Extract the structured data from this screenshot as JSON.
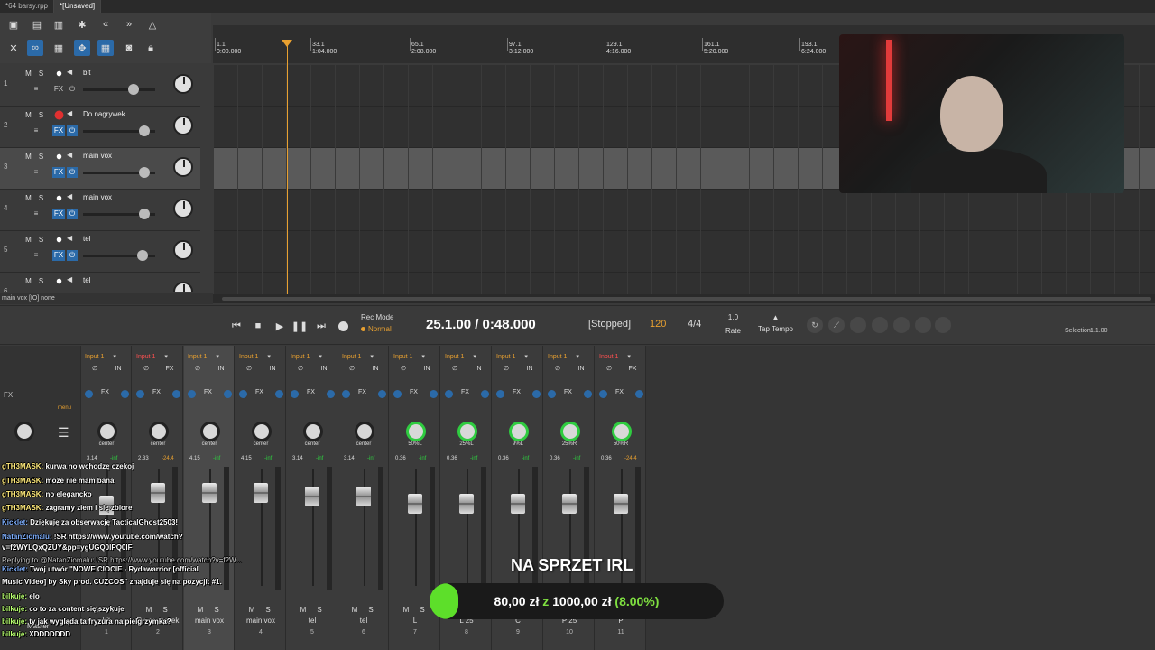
{
  "titlebar": {
    "tabs": [
      "*64 barsy.rpp",
      "*[Unsaved]"
    ]
  },
  "toolbar": {
    "icons": [
      "new-project-icon",
      "open-icon",
      "save-icon",
      "settings-icon",
      "rewind-icon",
      "fast-forward-icon",
      "metronome-icon",
      "grid-icon",
      "ripple-icon",
      "snap-icon",
      "lock-icon"
    ]
  },
  "ruler": {
    "marks": [
      {
        "bar": "1.1",
        "time": "0:00.000"
      },
      {
        "bar": "33.1",
        "time": "1:04.000"
      },
      {
        "bar": "65.1",
        "time": "2:08.000"
      },
      {
        "bar": "97.1",
        "time": "3:12.000"
      },
      {
        "bar": "129.1",
        "time": "4:16.000"
      },
      {
        "bar": "161.1",
        "time": "5:20.000"
      },
      {
        "bar": "193.1",
        "time": "6:24.000"
      }
    ]
  },
  "tracks": [
    {
      "num": "1",
      "name": "bit",
      "armed": false,
      "fx_on": false,
      "selected": false
    },
    {
      "num": "2",
      "name": "Do nagrywek",
      "armed": true,
      "fx_on": true,
      "selected": false
    },
    {
      "num": "3",
      "name": "main vox",
      "armed": false,
      "fx_on": true,
      "selected": true
    },
    {
      "num": "4",
      "name": "main vox",
      "armed": false,
      "fx_on": true,
      "selected": false
    },
    {
      "num": "5",
      "name": "tel",
      "armed": false,
      "fx_on": true,
      "selected": false
    },
    {
      "num": "6",
      "name": "tel",
      "armed": false,
      "fx_on": true,
      "selected": false
    }
  ],
  "track_labels": {
    "mute": "M",
    "solo": "S",
    "fx": "FX"
  },
  "status_line": "main vox [IO] none",
  "transport": {
    "rec_mode_label": "Rec Mode",
    "rec_mode_value": "Normal",
    "position": "25.1.00 / 0:48.000",
    "state": "[Stopped]",
    "bpm": "120",
    "time_sig": "4/4",
    "rate_value": "1.0",
    "rate_label": "Rate",
    "tap_tempo_label": "Tap Tempo",
    "selection_label": "Selection:",
    "selection_value": "1.1.00"
  },
  "mixer": {
    "master_label": "Master",
    "menu_label": "menu",
    "strips": [
      {
        "input": "Input 1",
        "armed": false,
        "pan": "center",
        "vol": "3.14",
        "peak": "-inf",
        "name": "bit",
        "num": "1"
      },
      {
        "input": "Input 1",
        "armed": true,
        "pan": "center",
        "vol": "2.33",
        "peak": "-24.4",
        "name": "Do nagrywek",
        "num": "2"
      },
      {
        "input": "Input 1",
        "armed": false,
        "pan": "center",
        "vol": "4.15",
        "peak": "-inf",
        "name": "main vox",
        "num": "3"
      },
      {
        "input": "Input 1",
        "armed": false,
        "pan": "center",
        "vol": "4.15",
        "peak": "-inf",
        "name": "main vox",
        "num": "4"
      },
      {
        "input": "Input 1",
        "armed": false,
        "pan": "center",
        "vol": "3.14",
        "peak": "-inf",
        "name": "tel",
        "num": "5"
      },
      {
        "input": "Input 1",
        "armed": false,
        "pan": "center",
        "vol": "3.14",
        "peak": "-inf",
        "name": "tel",
        "num": "6"
      },
      {
        "input": "Input 1",
        "armed": false,
        "pan": "50%L",
        "vol": "0.36",
        "peak": "-inf",
        "name": "L",
        "num": "7"
      },
      {
        "input": "Input 1",
        "armed": false,
        "pan": "25%L",
        "vol": "0.36",
        "peak": "-inf",
        "name": "L 25",
        "num": "8"
      },
      {
        "input": "Input 1",
        "armed": false,
        "pan": "9%L",
        "vol": "0.36",
        "peak": "-inf",
        "name": "C",
        "num": "9"
      },
      {
        "input": "Input 1",
        "armed": false,
        "pan": "25%R",
        "vol": "0.36",
        "peak": "-inf",
        "name": "P 25",
        "num": "10"
      },
      {
        "input": "Input 1",
        "armed": true,
        "pan": "50%R",
        "vol": "0.36",
        "peak": "-24.4",
        "name": "P",
        "num": "11"
      }
    ]
  },
  "chat": [
    {
      "user": "gTH3MASK:",
      "msg": "kurwa no wchodzę czekoj",
      "color": "y"
    },
    {
      "user": "gTH3MASK:",
      "msg": "może nie mam bana",
      "color": "y"
    },
    {
      "user": "gTH3MASK:",
      "msg": "no elegancko",
      "color": "y"
    },
    {
      "user": "gTH3MASK:",
      "msg": "zagramy ziem i się zbiore",
      "color": "y"
    },
    {
      "user": "Kicklet:",
      "msg": "Dziękuję za obserwację TacticalGhost2503!",
      "color": "b"
    },
    {
      "user": "NatanZiomalu:",
      "msg": "!SR https://www.youtube.com/watch?",
      "color": "b"
    },
    {
      "user": "",
      "msg": "v=f2WYLQxQZUY&pp=ygUGQ0lPQ0lF",
      "color": "w"
    },
    {
      "user": "",
      "msg": "Replying to @NatanZiomalu: !SR https://www.youtube.com/watch?v=f2W...",
      "color": "s"
    },
    {
      "user": "Kicklet:",
      "msg": "Twój utwór \"NOWE CIOCIE - Rydawarrior [official",
      "color": "b"
    },
    {
      "user": "",
      "msg": "Music Video] by Sky prod. CUZCOS\" znajduje się na pozycji: #1.",
      "color": "w"
    },
    {
      "user": "bilkuje:",
      "msg": "elo",
      "color": "g"
    },
    {
      "user": "bilkuje:",
      "msg": "co to za content się szykuje",
      "color": "g"
    },
    {
      "user": "bilkuje:",
      "msg": "ty jak wygląda ta fryzura na pielgrzymka?",
      "color": "g"
    },
    {
      "user": "bilkuje:",
      "msg": "XDDDDDDD",
      "color": "g"
    }
  ],
  "goal": {
    "title": "NA SPRZET IRL",
    "current": "80,00 zł",
    "sep": "z",
    "target": "1000,00 zł",
    "percent_text": "(8.00%)",
    "progress": 0.08
  },
  "colors": {
    "accent_blue": "#2b6aa8",
    "accent_orange": "#e8a030",
    "rec_red": "#e03030",
    "goal_green": "#5ddf2a"
  }
}
